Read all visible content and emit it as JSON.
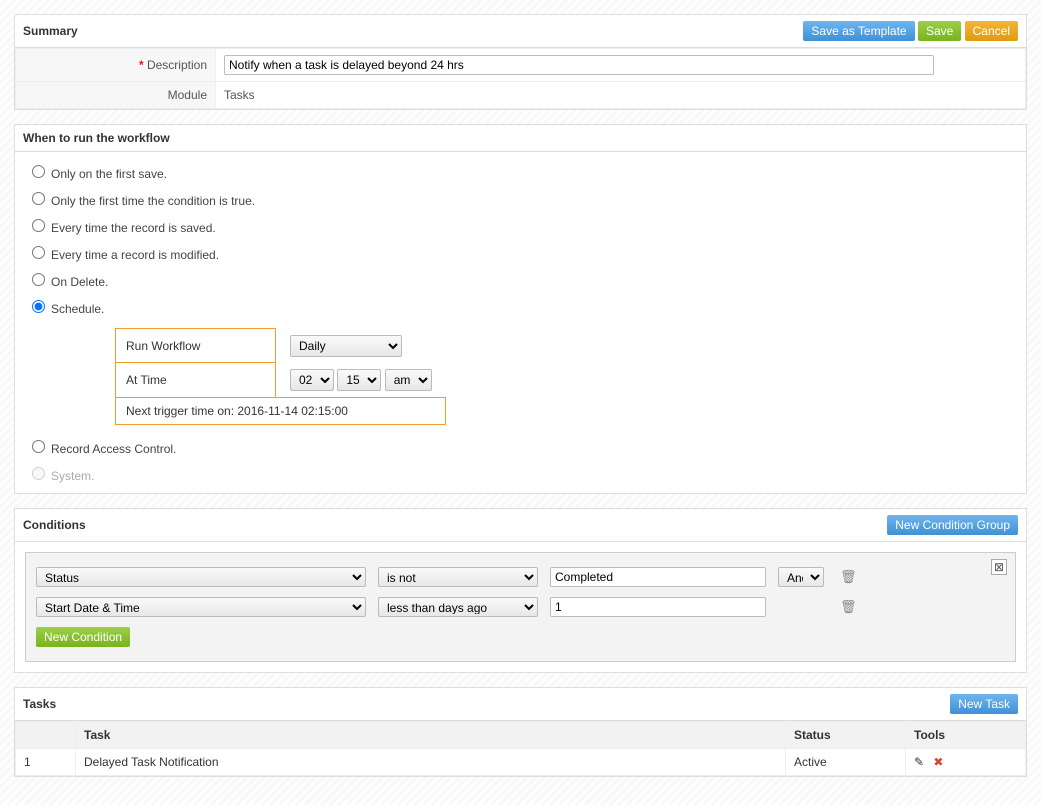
{
  "summary": {
    "title": "Summary",
    "save_template_label": "Save as Template",
    "save_label": "Save",
    "cancel_label": "Cancel",
    "desc_label": "Description",
    "desc_value": "Notify when a task is delayed beyond 24 hrs",
    "module_label": "Module",
    "module_value": "Tasks"
  },
  "when": {
    "title": "When to run the workflow",
    "opt_first_save": "Only on the first save.",
    "opt_first_cond": "Only the first time the condition is true.",
    "opt_every_save": "Every time the record is saved.",
    "opt_every_modify": "Every time a record is modified.",
    "opt_on_delete": "On Delete.",
    "opt_schedule": "Schedule.",
    "opt_rac": "Record Access Control.",
    "opt_system": "System.",
    "schedule": {
      "run_label": "Run Workflow",
      "freq": "Daily",
      "at_label": "At Time",
      "hh": "02",
      "mm": "15",
      "ap": "am",
      "next": "Next trigger time on: 2016-11-14 02:15:00"
    }
  },
  "conditions": {
    "title": "Conditions",
    "new_group_label": "New Condition Group",
    "new_cond_label": "New Condition",
    "rows": [
      {
        "field": "Status",
        "op": "is not",
        "value": "Completed",
        "join": "And"
      },
      {
        "field": "Start Date & Time",
        "op": "less than days ago",
        "value": "1",
        "join": ""
      }
    ]
  },
  "tasks": {
    "title": "Tasks",
    "new_task_label": "New Task",
    "col_task": "Task",
    "col_status": "Status",
    "col_tools": "Tools",
    "rows": [
      {
        "idx": "1",
        "name": "Delayed Task Notification",
        "status": "Active"
      }
    ]
  }
}
